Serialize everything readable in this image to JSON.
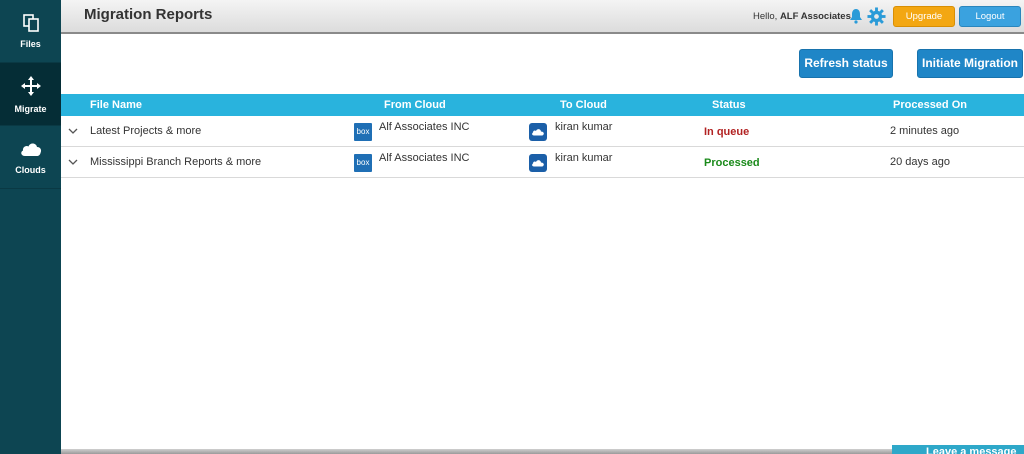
{
  "sidebar": {
    "items": [
      {
        "label": "Files",
        "icon": "files-icon"
      },
      {
        "label": "Migrate",
        "icon": "migrate-icon",
        "active": true
      },
      {
        "label": "Clouds",
        "icon": "cloud-icon"
      }
    ]
  },
  "header": {
    "title": "Migration Reports",
    "greeting": "Hello,",
    "user": "ALF Associates",
    "upgrade_label": "Upgrade",
    "logout_label": "Logout"
  },
  "actions": {
    "refresh_label": "Refresh status",
    "initiate_label": "Initiate Migration"
  },
  "table": {
    "columns": [
      "File Name",
      "From Cloud",
      "To Cloud",
      "Status",
      "Processed On"
    ],
    "rows": [
      {
        "file_name": "Latest Projects & more",
        "from_logo": "box",
        "from_cloud": "Alf Associates INC",
        "to_cloud": "kiran kumar",
        "status": "In queue",
        "status_color": "#b22222",
        "processed_on": "2 minutes ago"
      },
      {
        "file_name": "Mississippi Branch Reports & more",
        "from_logo": "box",
        "from_cloud": "Alf Associates INC",
        "to_cloud": "kiran kumar",
        "status": "Processed",
        "status_color": "#1a8a1a",
        "processed_on": "20 days ago"
      }
    ]
  },
  "chat": {
    "label": "Leave a message"
  },
  "colors": {
    "sidebar": "#0d4552",
    "table_header": "#29b3dd",
    "primary_button": "#1f86c7",
    "upgrade": "#f3a712"
  }
}
